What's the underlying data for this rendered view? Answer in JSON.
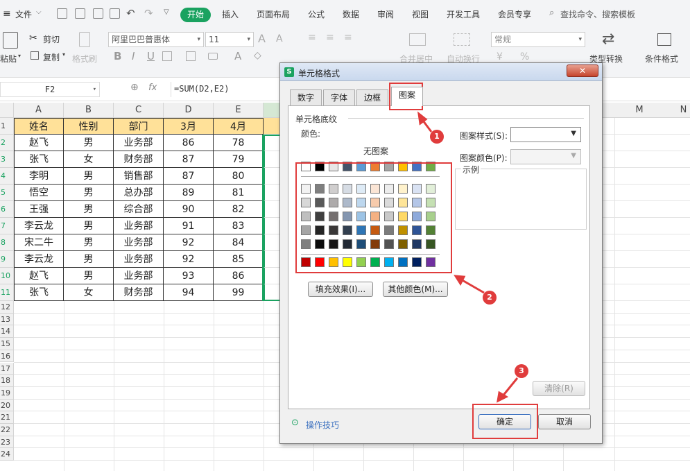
{
  "menubar": {
    "file_label": "文件",
    "start_tab": "开始",
    "tabs": [
      "插入",
      "页面布局",
      "公式",
      "数据",
      "审阅",
      "视图",
      "开发工具",
      "会员专享"
    ],
    "search_placeholder": "查找命令、搜索模板"
  },
  "ribbon": {
    "paste": "粘贴",
    "cut": "剪切",
    "copy": "复制",
    "format_painter": "格式刷",
    "font_name": "阿里巴巴普惠体",
    "font_size": "11",
    "bold": "B",
    "italic": "I",
    "underline": "U",
    "font_color_glyph": "A",
    "number_format": "常规",
    "merge_center": "合并居中",
    "auto_wrap": "自动换行",
    "type_convert": "类型转换",
    "conditional_format": "条件格式",
    "percent_glyph": "%",
    "currency_glyph": "¥"
  },
  "formula_bar": {
    "cell_ref": "F2",
    "fx_label": "fx",
    "formula": "=SUM(D2,E2)"
  },
  "sheet": {
    "columns": [
      "A",
      "B",
      "C",
      "D",
      "E"
    ],
    "far_columns": [
      "M",
      "N"
    ],
    "header_row": [
      "姓名",
      "性别",
      "部门",
      "3月",
      "4月"
    ],
    "rows": [
      [
        "赵飞",
        "男",
        "业务部",
        "86",
        "78"
      ],
      [
        "张飞",
        "女",
        "财务部",
        "87",
        "79"
      ],
      [
        "李明",
        "男",
        "销售部",
        "87",
        "80"
      ],
      [
        "悟空",
        "男",
        "总办部",
        "89",
        "81"
      ],
      [
        "王强",
        "男",
        "综合部",
        "90",
        "82"
      ],
      [
        "李云龙",
        "男",
        "业务部",
        "91",
        "83"
      ],
      [
        "宋二牛",
        "男",
        "业务部",
        "92",
        "84"
      ],
      [
        "李云龙",
        "男",
        "业务部",
        "92",
        "85"
      ],
      [
        "赵飞",
        "男",
        "业务部",
        "93",
        "86"
      ],
      [
        "张飞",
        "女",
        "财务部",
        "94",
        "99"
      ]
    ],
    "row_numbers": [
      "1",
      "2",
      "3",
      "4",
      "5",
      "6",
      "7",
      "8",
      "9",
      "10",
      "11",
      "12",
      "13",
      "14",
      "15",
      "16",
      "17",
      "18",
      "19",
      "20",
      "21",
      "22",
      "23",
      "24"
    ]
  },
  "dialog": {
    "title": "单元格格式",
    "close_glyph": "✕",
    "tabs": [
      "数字",
      "字体",
      "边框",
      "图案"
    ],
    "active_tab": "图案",
    "section_title": "单元格底纹",
    "color_label": "颜色:",
    "no_pattern": "无图案",
    "pattern_style_label": "图案样式(S):",
    "pattern_color_label": "图案颜色(P):",
    "sample_label": "示例",
    "fill_effects_btn": "填充效果(I)...",
    "more_colors_btn": "其他颜色(M)...",
    "clear_btn": "清除(R)",
    "tips_link": "操作技巧",
    "ok_btn": "确定",
    "cancel_btn": "取消",
    "palette_top": [
      "#ffffff",
      "#000000",
      "#e7e6e6",
      "#44546a",
      "#5b9bd5",
      "#ed7d31",
      "#a5a5a5",
      "#ffc000",
      "#4472c4",
      "#70ad47"
    ],
    "palette_tints": [
      [
        "#f2f2f2",
        "#7f7f7f",
        "#d0cece",
        "#d6dce4",
        "#deebf6",
        "#fbe5d5",
        "#ededed",
        "#fff2cc",
        "#d9e2f3",
        "#e2efd9"
      ],
      [
        "#d8d8d8",
        "#595959",
        "#aeabab",
        "#adb9ca",
        "#bdd7ee",
        "#f7cbac",
        "#dbdbdb",
        "#fee599",
        "#b4c6e7",
        "#c5e0b3"
      ],
      [
        "#bfbfbf",
        "#3f3f3f",
        "#757070",
        "#8496b0",
        "#9cc3e5",
        "#f4b183",
        "#c9c9c9",
        "#ffd965",
        "#8eaadb",
        "#a8d08d"
      ],
      [
        "#a5a5a5",
        "#262626",
        "#3a3838",
        "#323f4f",
        "#2e75b5",
        "#c55a11",
        "#7b7b7b",
        "#bf9000",
        "#2f5496",
        "#538135"
      ],
      [
        "#7f7f7f",
        "#0c0c0c",
        "#171616",
        "#222a35",
        "#1e4e79",
        "#833c0b",
        "#525252",
        "#7f6000",
        "#1f3864",
        "#375623"
      ]
    ],
    "palette_standard": [
      "#c00000",
      "#ff0000",
      "#ffc000",
      "#ffff00",
      "#92d050",
      "#00b050",
      "#00b0f0",
      "#0070c0",
      "#002060",
      "#7030a0"
    ]
  },
  "annotations": {
    "callout_1": "1",
    "callout_2": "2",
    "callout_3": "3",
    "highlight_color": "#e03c3c"
  }
}
